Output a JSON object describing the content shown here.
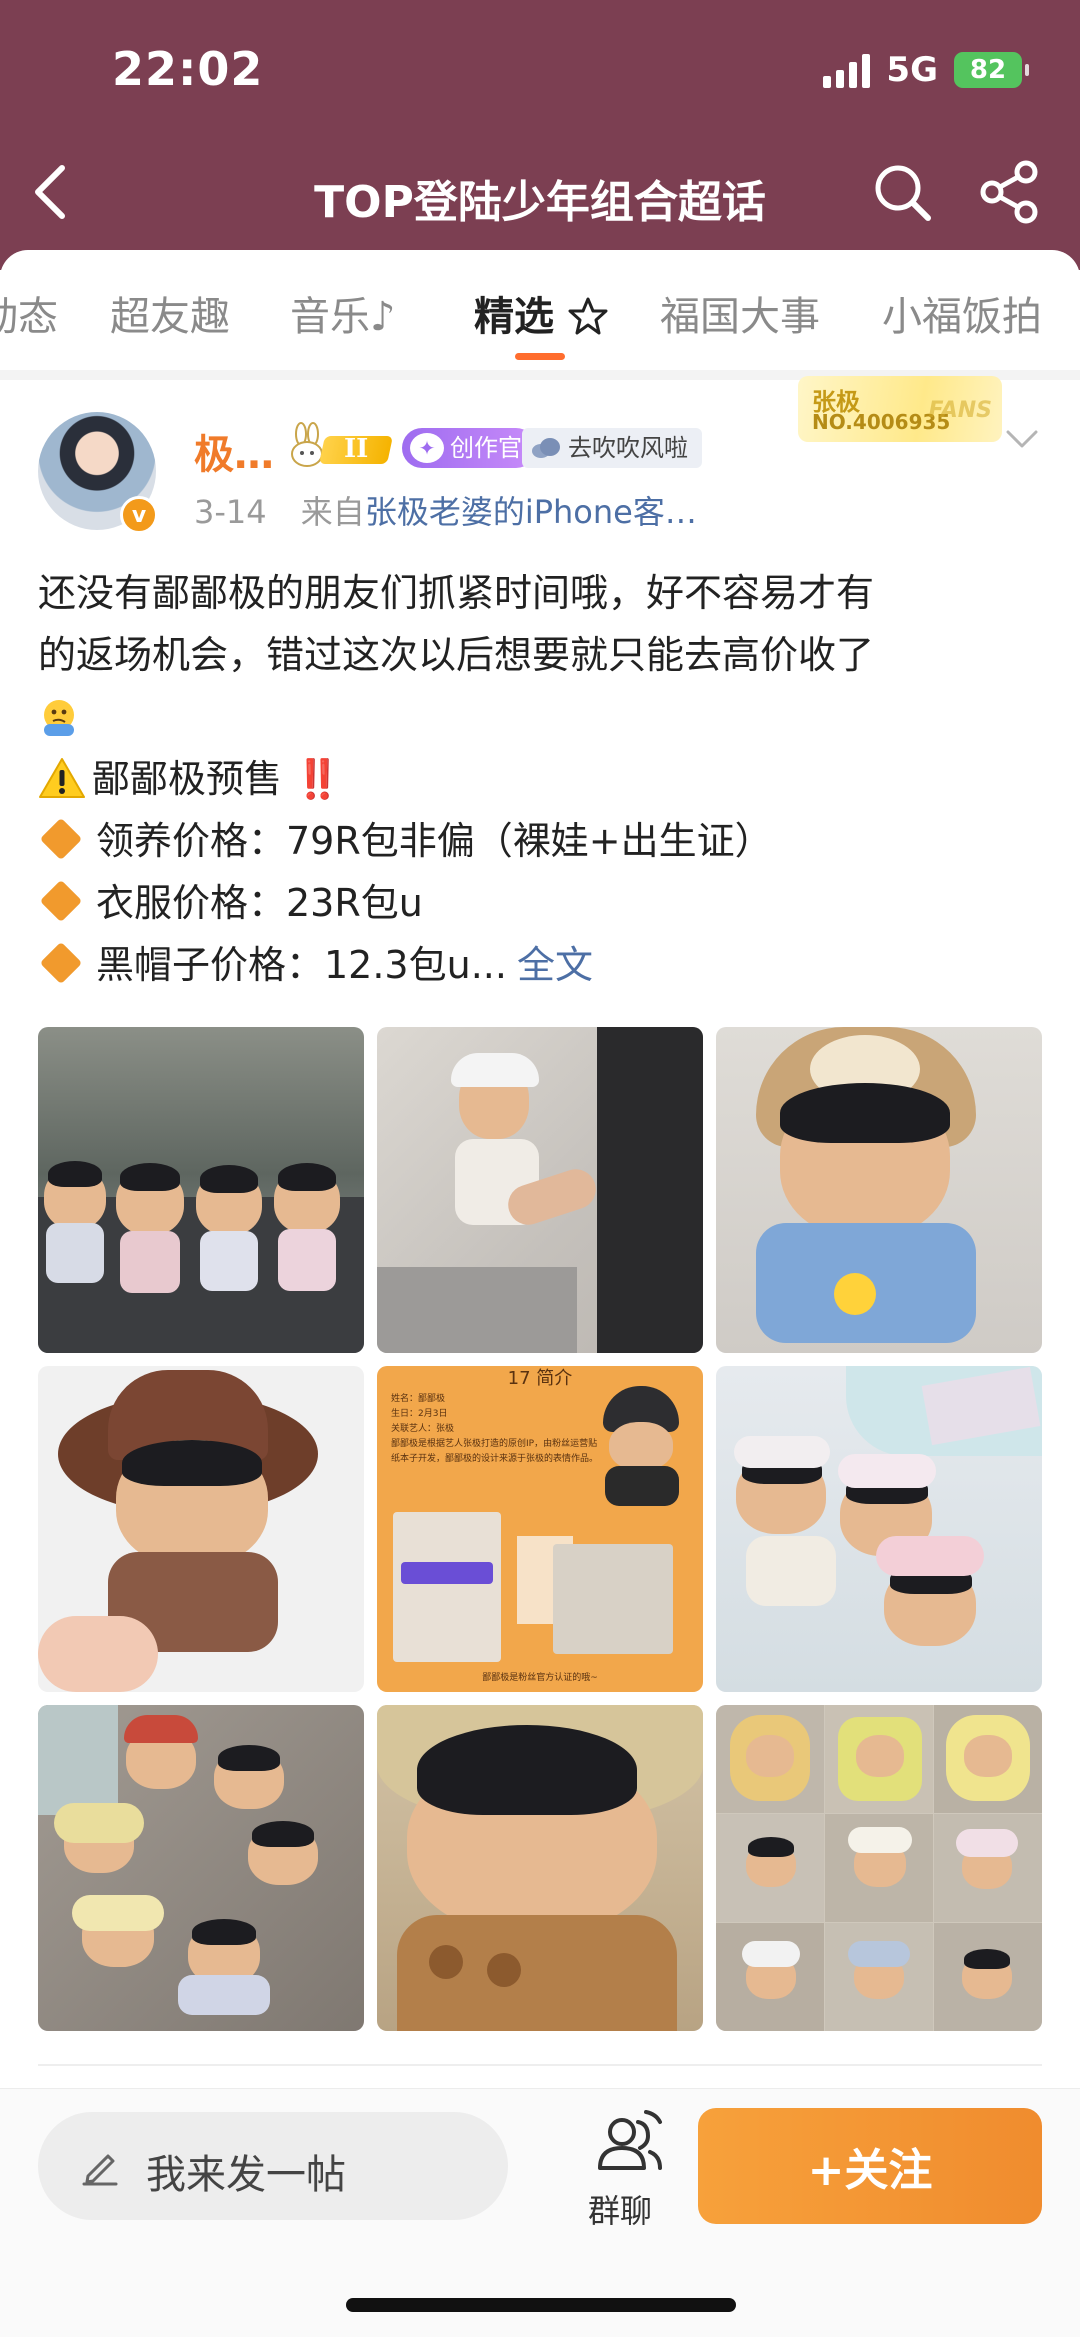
{
  "status_bar": {
    "time": "22:02",
    "network": "5G",
    "battery": "82"
  },
  "nav": {
    "title": "TOP登陆少年组合超话"
  },
  "tabs": [
    {
      "label": "动态",
      "active": false
    },
    {
      "label": "超友趣",
      "active": false
    },
    {
      "label": "音乐♪",
      "active": false
    },
    {
      "label": "精选",
      "active": true
    },
    {
      "label": "福国大事",
      "active": false
    },
    {
      "label": "小福饭拍",
      "active": false
    }
  ],
  "post": {
    "username": "极…",
    "level_badge": "II",
    "creator_badge": "创作官",
    "group_badge": "去吹吹风啦",
    "fan_badge": {
      "name": "张极",
      "number": "NO.4006935",
      "fans": "FANS"
    },
    "time": "3-14",
    "source_prefix": "来自",
    "source": "张极老婆的iPhone客…",
    "text": {
      "line1": "还没有鄙鄙极的朋友们抓紧时间哦，好不容易才有",
      "line2": "的返场机会，错过这次以后想要就只能去高价收了",
      "presale": "鄙鄙极预售",
      "presale_mark": "‼️",
      "price1": "领养价格：79R包非偏（裸娃+出生证）",
      "price2": "衣服价格：23R包u",
      "price3": "黑帽子价格：12.3包u...",
      "fulltext": "全文"
    },
    "photos": [
      {
        "name": "photo-dolls-lineup",
        "colors": [
          "#8e9186",
          "#c9ccd4"
        ]
      },
      {
        "name": "photo-doll-dressing",
        "colors": [
          "#d9d6d3",
          "#2b2b2b"
        ]
      },
      {
        "name": "photo-doll-bear-hat",
        "colors": [
          "#e8e4df",
          "#c9a77a"
        ]
      },
      {
        "name": "photo-doll-brown-hat",
        "colors": [
          "#f2f2f2",
          "#6a3c2a"
        ]
      },
      {
        "name": "photo-doll-profile-card",
        "colors": [
          "#f2a74b",
          "#f2a74b"
        ]
      },
      {
        "name": "photo-dolls-bunny-hats",
        "colors": [
          "#e9ecef",
          "#cfe3e6"
        ]
      },
      {
        "name": "photo-dolls-circle",
        "colors": [
          "#8e8780",
          "#b5aea6"
        ]
      },
      {
        "name": "photo-doll-straw-hat",
        "colors": [
          "#c5b39a",
          "#8d7458"
        ]
      },
      {
        "name": "photo-doll-collage",
        "colors": [
          "#d8d2c8",
          "#b9b0a3"
        ]
      }
    ],
    "card_texts": {
      "title": "17 简介",
      "info1": "姓名：鄙鄙极",
      "info2": "生日：2月3日",
      "info3": "关联艺人：张极",
      "info4": "鄙鄙极是根据艺人张极打造的原创IP，由粉丝运营贴纸本子开发，鄙鄙极的设计来源于张极的表情作品。",
      "footer": "鄙鄙极是粉丝官方认证的哦~"
    }
  },
  "bottom": {
    "compose_label": "我来发一帖",
    "group_label": "群聊",
    "follow_label": "+关注"
  },
  "colors": {
    "header": "#7c3f52",
    "accent": "#f08c2e",
    "link": "#4d6fa5",
    "username": "#f07b2a"
  }
}
